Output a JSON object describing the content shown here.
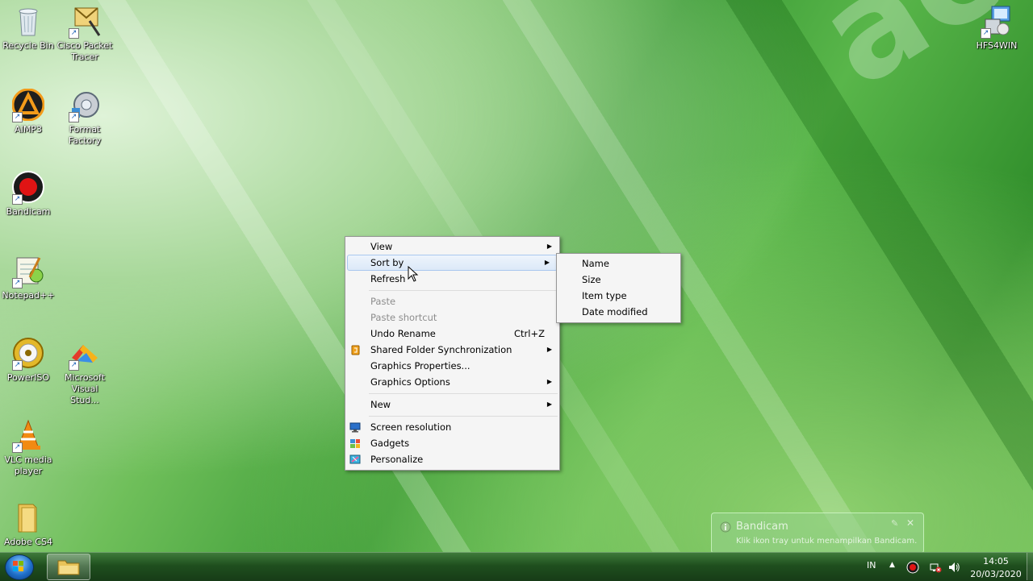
{
  "brand": "acer",
  "desktop_icons": [
    {
      "label": "Recycle Bin"
    },
    {
      "label": "Cisco Packet Tracer"
    },
    {
      "label": "AIMP3"
    },
    {
      "label": "Format Factory"
    },
    {
      "label": "Bandicam"
    },
    {
      "label": "Notepad++"
    },
    {
      "label": "PowerISO"
    },
    {
      "label": "Microsoft Visual Stud..."
    },
    {
      "label": "VLC media player"
    },
    {
      "label": "Adobe CS4"
    },
    {
      "label": "HFS4WIN"
    }
  ],
  "context_menu": {
    "items": [
      {
        "label": "View"
      },
      {
        "label": "Sort by"
      },
      {
        "label": "Refresh"
      },
      {
        "label": "Paste"
      },
      {
        "label": "Paste shortcut"
      },
      {
        "label": "Undo Rename",
        "shortcut": "Ctrl+Z"
      },
      {
        "label": "Shared Folder Synchronization"
      },
      {
        "label": "Graphics Properties..."
      },
      {
        "label": "Graphics Options"
      },
      {
        "label": "New"
      },
      {
        "label": "Screen resolution"
      },
      {
        "label": "Gadgets"
      },
      {
        "label": "Personalize"
      }
    ]
  },
  "sort_submenu": {
    "items": [
      {
        "label": "Name"
      },
      {
        "label": "Size"
      },
      {
        "label": "Item type"
      },
      {
        "label": "Date modified"
      }
    ]
  },
  "notification": {
    "title": "Bandicam",
    "message": "Klik ikon tray untuk menampilkan Bandicam."
  },
  "taskbar": {
    "language": "IN",
    "time": "14:05",
    "date": "20/03/2020"
  },
  "colors": {
    "menu_bg": "#f5f5f5",
    "highlight": "#dce9f8",
    "taskbar": "#1f4f1e"
  }
}
